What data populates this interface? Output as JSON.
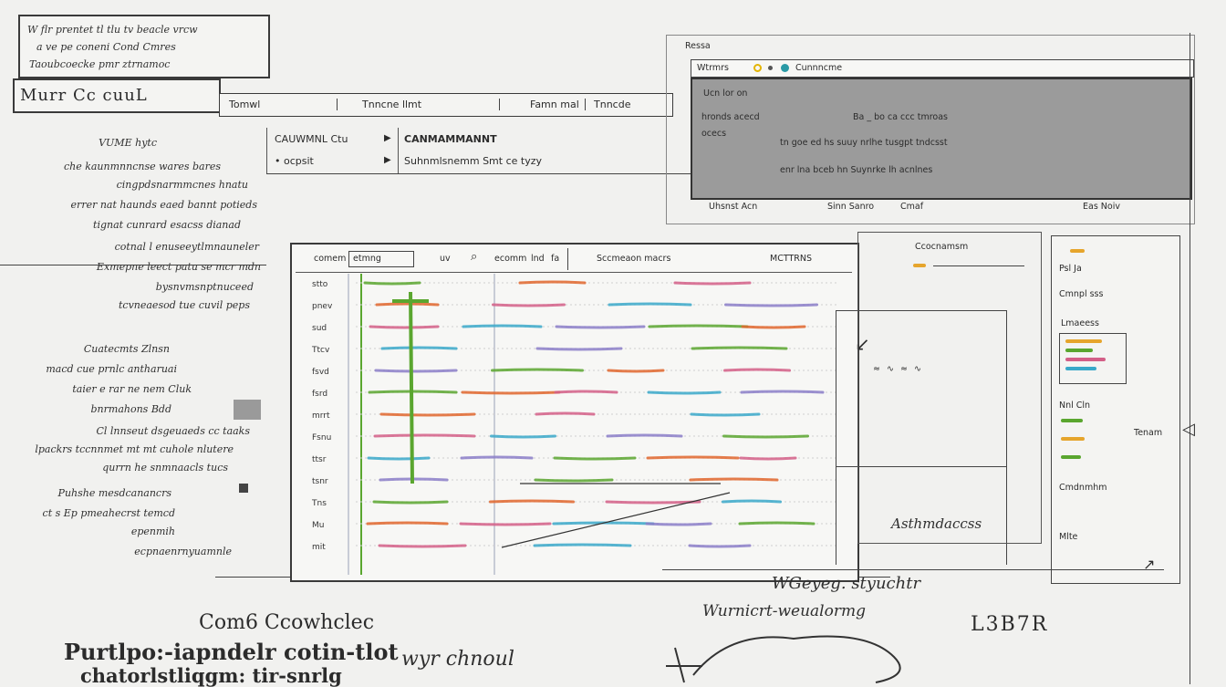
{
  "top_left_box": {
    "lines": [
      "W flr prentet tl tlu tv beacle vrcw",
      "a ve pe coneni Cond Cmres",
      "Taoubcoecke pmr ztrnamoc"
    ]
  },
  "header": {
    "title": "Murr Cc cuuL",
    "tabs": [
      "Tomwl",
      "Tnncne llmt",
      "Famn mal",
      "Tnncde"
    ]
  },
  "menu": {
    "left": [
      "CAUWMNL Ctu",
      "• ocpsit"
    ],
    "right_title": "CANMAMMANNT",
    "right_sub": "Suhnmlsnemm Smt ce tyzy"
  },
  "left_annotations": [
    "VUME hytc",
    "che kaunmnncnse wares bares",
    "cingpdsnarmmcnes hnatu",
    "errer nat haunds eaed bannt potieds",
    "tignat cunrard esacss dianad",
    "cotnal l enuseeytlmnauneler",
    "Exmepne leect patu se mcr mdn",
    "bysnvmsnptnuceed",
    "tcvneaesod tue cuvil peps",
    "Cuatecmts Zlnsn",
    "macd cue prnlc antharuai",
    "taier e rar ne nem Cluk",
    "bnrmahons Bdd",
    "Cl lnnseut dsgeuaeds cc taaks",
    "lpackrs tccnnmet mt mt cuhole nlutere",
    "qurrn he snmnaacls tucs",
    "Puhshe mesdcanancrs",
    "ct s Ep pmeahecrst temcd",
    "epenmih",
    "ecpnaenrnyuamnle"
  ],
  "chart_panel": {
    "toolbar": [
      "comem",
      "etmng",
      "uv",
      "ecomm",
      "lnd",
      "fa"
    ],
    "toolbar_title": "Sccmeaon macrs",
    "toolbar_right": "MCTTRNS",
    "row_labels": [
      "stto",
      "pnev",
      "sud",
      "Ttcv",
      "fsvd",
      "fsrd",
      "mrrt",
      "Fsnu",
      "ttsr",
      "tsnr",
      "Tns",
      "Mu",
      "mit"
    ],
    "series_colors": [
      "#5aa62f",
      "#e0662d",
      "#d35f87",
      "#39a8c9",
      "#8b7ec8"
    ]
  },
  "browser": {
    "top_label": "Ressa",
    "address": "Wtrmrs",
    "address_right": "Cunnncme",
    "rows": [
      "Ucn  lor  on",
      "hronds  acecd",
      "ocecs",
      "Ba _ bo  ca ccc tmroas",
      "tn goe ed hs  suuy  nrlhe  tusgpt  tndcsst",
      "enr  lna  bceb  hn  Suynrke  lh acnlnes"
    ],
    "footer": [
      "Uhsnst Acn",
      "Sinn Sanro",
      "Cmaf",
      "Eas Noiv"
    ]
  },
  "right_panel": {
    "title": "Ccocnamsm",
    "legend_title": "Lmaeess",
    "labels": [
      "Psl Ja",
      "Cmnpl sss",
      "Nnl  Cln",
      "Tenam",
      "Cmdnmhm",
      "Mlte"
    ],
    "colors": [
      "#e6a52c",
      "#5aa62f",
      "#d35f87",
      "#39a8c9"
    ]
  },
  "callouts": {
    "middle": "Asthmdaccss",
    "bottom_a": "WGeyeg.  styuchtr",
    "bottom_b": "Wurnicrt-weualormg",
    "right_code": "L3B7R"
  },
  "bottom_titles": {
    "line1": "Com6 Ccowhclec",
    "line2": "Purtlpo:-iapndelr cotin-tlot",
    "line3": "chatorlstliqgm: tir-snrlg",
    "right": "wyr chnoul"
  }
}
